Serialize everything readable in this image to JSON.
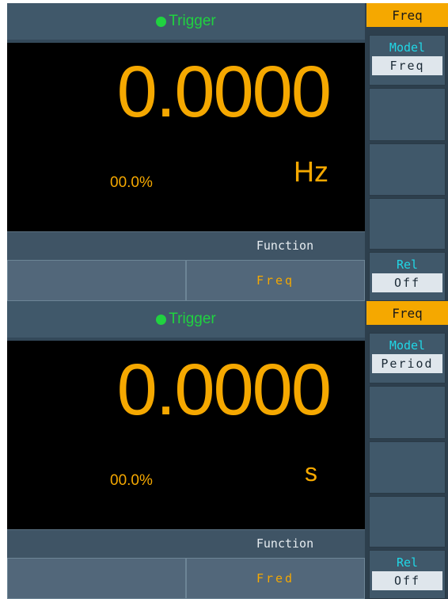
{
  "panels": [
    {
      "title": "Trigger",
      "value": "0.0000",
      "percent": "00.0%",
      "unit": "Hz",
      "function_label": "Function",
      "function_value": "Freq",
      "side": {
        "header": "Freq",
        "model_label": "Model",
        "model_value": "Freq",
        "rel_label": "Rel",
        "rel_value": "Off"
      }
    },
    {
      "title": "Trigger",
      "value": "0.0000",
      "percent": "00.0%",
      "unit": "s",
      "function_label": "Function",
      "function_value": "Fred",
      "side": {
        "header": "Freq",
        "model_label": "Model",
        "model_value": "Period",
        "rel_label": "Rel",
        "rel_value": "Off"
      }
    }
  ],
  "colors": {
    "trigger_green": "#20d240",
    "value_amber": "#f5a800",
    "label_cyan": "#20d7e6",
    "panel_bg": "#000000",
    "bar_bg": "#40586a"
  }
}
